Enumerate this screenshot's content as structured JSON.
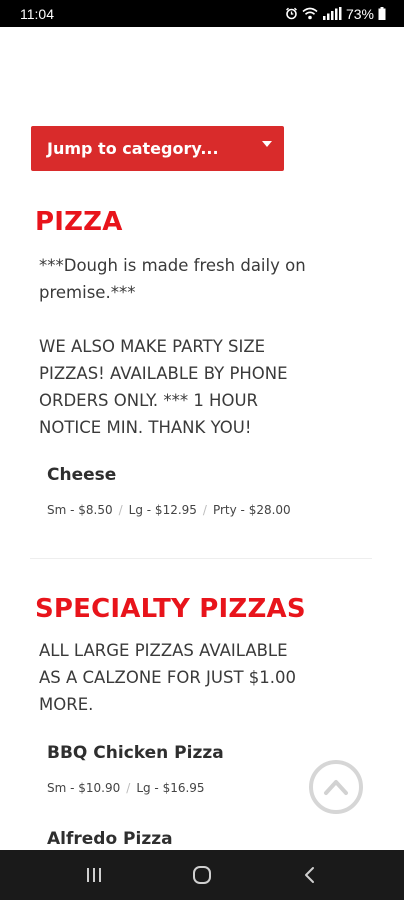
{
  "status_bar": {
    "time": "11:04",
    "battery": "73%",
    "icons": [
      "alarm-icon",
      "wifi-icon",
      "signal-icon",
      "battery-icon"
    ]
  },
  "jump": {
    "label": "Jump to category..."
  },
  "sections": [
    {
      "title": "PIZZA",
      "description_lines": [
        "***Dough is made fresh daily on",
        "premise.***",
        "",
        "WE ALSO MAKE PARTY SIZE",
        "PIZZAS! AVAILABLE BY PHONE",
        "ORDERS ONLY. *** 1 HOUR",
        "NOTICE MIN. THANK YOU!"
      ],
      "items": [
        {
          "name": "Cheese",
          "prices": [
            "Sm - $8.50",
            "Lg - $12.95",
            "Prty - $28.00"
          ]
        }
      ]
    },
    {
      "title": "SPECIALTY PIZZAS",
      "description_lines": [
        "ALL LARGE PIZZAS AVAILABLE",
        "AS A CALZONE FOR JUST $1.00",
        "MORE."
      ],
      "items": [
        {
          "name": "BBQ Chicken Pizza",
          "prices": [
            "Sm - $10.90",
            "Lg - $16.95"
          ]
        },
        {
          "name": "Alfredo Pizza",
          "prices": []
        }
      ]
    }
  ],
  "colors": {
    "accent": "#e8141b",
    "button": "#d92b2b",
    "nav_bar": "#1a1a1a"
  },
  "nav": {
    "icons": [
      "recent-apps-icon",
      "home-icon",
      "back-icon"
    ]
  }
}
